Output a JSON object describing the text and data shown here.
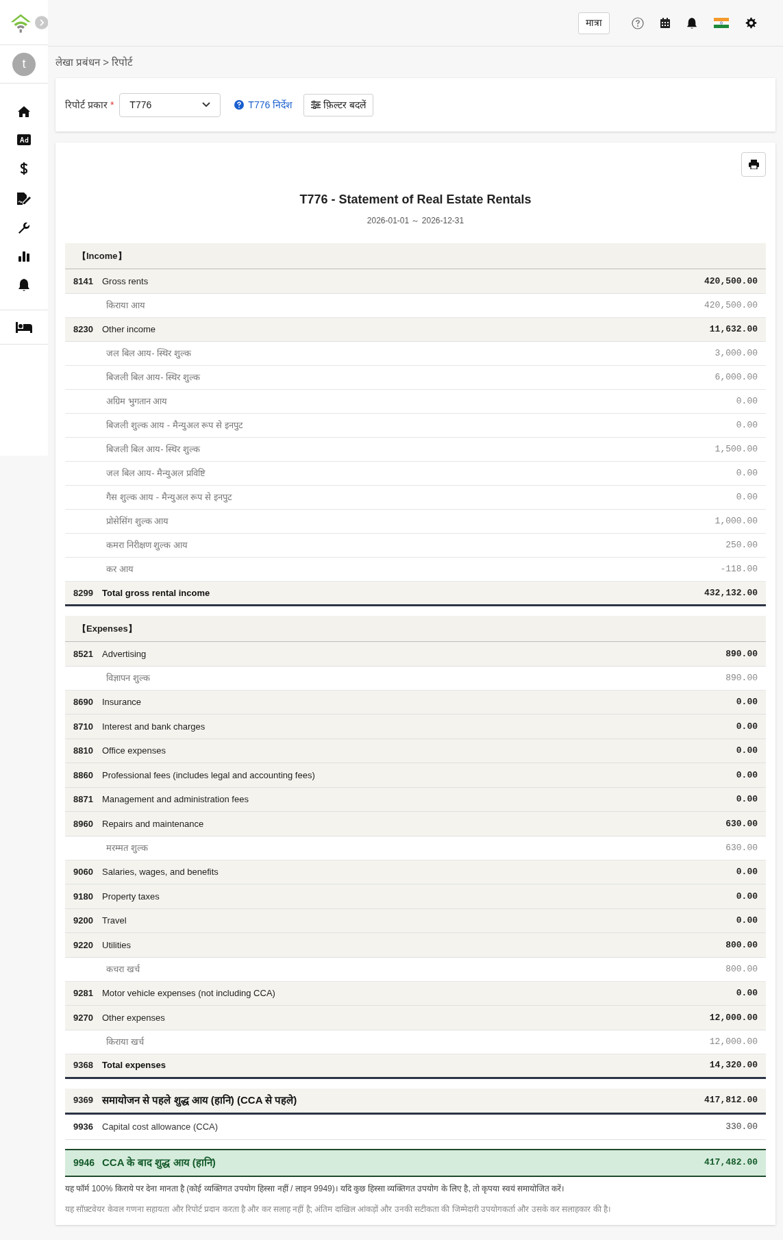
{
  "topbar": {
    "unit_button": "मात्रा"
  },
  "sidebar": {
    "avatar_initial": "t"
  },
  "breadcrumb": "लेखा प्रबंधन > रिपोर्ट",
  "filter": {
    "label": "रिपोर्ट प्रकार",
    "required_mark": "*",
    "report_type": "T776",
    "guide_link": "T776 निर्देश",
    "filter_button": "फ़िल्टर बदलें"
  },
  "report": {
    "title": "T776 - Statement of Real Estate Rentals",
    "period": "2026-01-01 ～ 2026-12-31",
    "rows": [
      {
        "kind": "section",
        "label": "【Income】"
      },
      {
        "kind": "line",
        "code": "8141",
        "label": "Gross rents",
        "amount": "420,500.00"
      },
      {
        "kind": "detail",
        "label": "किराया आय",
        "amount": "420,500.00"
      },
      {
        "kind": "line",
        "code": "8230",
        "label": "Other income",
        "amount": "11,632.00"
      },
      {
        "kind": "detail",
        "label": "जल बिल आय- स्थिर शुल्क",
        "amount": "3,000.00"
      },
      {
        "kind": "detail",
        "label": "बिजली बिल आय- स्थिर शुल्क",
        "amount": "6,000.00"
      },
      {
        "kind": "detail",
        "label": "अग्रिम भुगतान आय",
        "amount": "0.00"
      },
      {
        "kind": "detail",
        "label": "बिजली शुल्क आय - मैन्युअल रूप से इनपुट",
        "amount": "0.00"
      },
      {
        "kind": "detail",
        "label": "बिजली बिल आय- स्थिर शुल्क",
        "amount": "1,500.00"
      },
      {
        "kind": "detail",
        "label": "जल बिल आय- मैन्युअल प्रविष्टि",
        "amount": "0.00"
      },
      {
        "kind": "detail",
        "label": "गैस शुल्क आय - मैन्युअल रूप से इनपुट",
        "amount": "0.00"
      },
      {
        "kind": "detail",
        "label": "प्रोसेसिंग शुल्क आय",
        "amount": "1,000.00"
      },
      {
        "kind": "detail",
        "label": "कमरा निरीक्षण शुल्क आय",
        "amount": "250.00"
      },
      {
        "kind": "detail",
        "label": "कर आय",
        "amount": "-118.00"
      },
      {
        "kind": "total",
        "code": "8299",
        "label": "Total gross rental income",
        "amount": "432,132.00"
      },
      {
        "kind": "section",
        "label": "【Expenses】"
      },
      {
        "kind": "line",
        "code": "8521",
        "label": "Advertising",
        "amount": "890.00"
      },
      {
        "kind": "detail",
        "label": "विज्ञापन शुल्क",
        "amount": "890.00"
      },
      {
        "kind": "line",
        "code": "8690",
        "label": "Insurance",
        "amount": "0.00"
      },
      {
        "kind": "line",
        "code": "8710",
        "label": "Interest and bank charges",
        "amount": "0.00"
      },
      {
        "kind": "line",
        "code": "8810",
        "label": "Office expenses",
        "amount": "0.00"
      },
      {
        "kind": "line",
        "code": "8860",
        "label": "Professional fees (includes legal and accounting fees)",
        "amount": "0.00"
      },
      {
        "kind": "line",
        "code": "8871",
        "label": "Management and administration fees",
        "amount": "0.00"
      },
      {
        "kind": "line",
        "code": "8960",
        "label": "Repairs and maintenance",
        "amount": "630.00"
      },
      {
        "kind": "detail",
        "label": "मरम्मत शुल्क",
        "amount": "630.00"
      },
      {
        "kind": "line",
        "code": "9060",
        "label": "Salaries, wages, and benefits",
        "amount": "0.00"
      },
      {
        "kind": "line",
        "code": "9180",
        "label": "Property taxes",
        "amount": "0.00"
      },
      {
        "kind": "line",
        "code": "9200",
        "label": "Travel",
        "amount": "0.00"
      },
      {
        "kind": "line",
        "code": "9220",
        "label": "Utilities",
        "amount": "800.00"
      },
      {
        "kind": "detail",
        "label": "कचरा खर्च",
        "amount": "800.00"
      },
      {
        "kind": "line",
        "code": "9281",
        "label": "Motor vehicle expenses (not including CCA)",
        "amount": "0.00"
      },
      {
        "kind": "line",
        "code": "9270",
        "label": "Other expenses",
        "amount": "12,000.00"
      },
      {
        "kind": "detail",
        "label": "किराया खर्च",
        "amount": "12,000.00"
      },
      {
        "kind": "total",
        "code": "9368",
        "label": "Total expenses",
        "amount": "14,320.00"
      },
      {
        "kind": "net",
        "code": "9369",
        "label": "समायोजन से पहले शुद्ध आय (हानि) (CCA से पहले)",
        "amount": "417,812.00"
      },
      {
        "kind": "plain",
        "code": "9936",
        "label": "Capital cost allowance (CCA)",
        "amount": "330.00"
      },
      {
        "kind": "final",
        "code": "9946",
        "label": "CCA के बाद शुद्ध आय (हानि)",
        "amount": "417,482.00"
      }
    ],
    "notes": [
      {
        "text": "यह फॉर्म 100% किराये पर देना मानता है (कोई व्यक्तिगत उपयोग हिस्सा नहीं / लाइन 9949)। यदि कुछ हिस्सा व्यक्तिगत उपयोग के लिए है, तो कृपया स्वयं समायोजित करें।",
        "muted": false
      },
      {
        "text": "यह सॉफ़्टवेयर केवल गणना सहायता और रिपोर्ट प्रदान करता है और कर सलाह नहीं है; अंतिम दाखिल आंकड़ों और उनकी सटीकता की जिम्मेदारी उपयोगकर्ता और उसके कर सलाहकार की है।",
        "muted": true
      }
    ]
  }
}
